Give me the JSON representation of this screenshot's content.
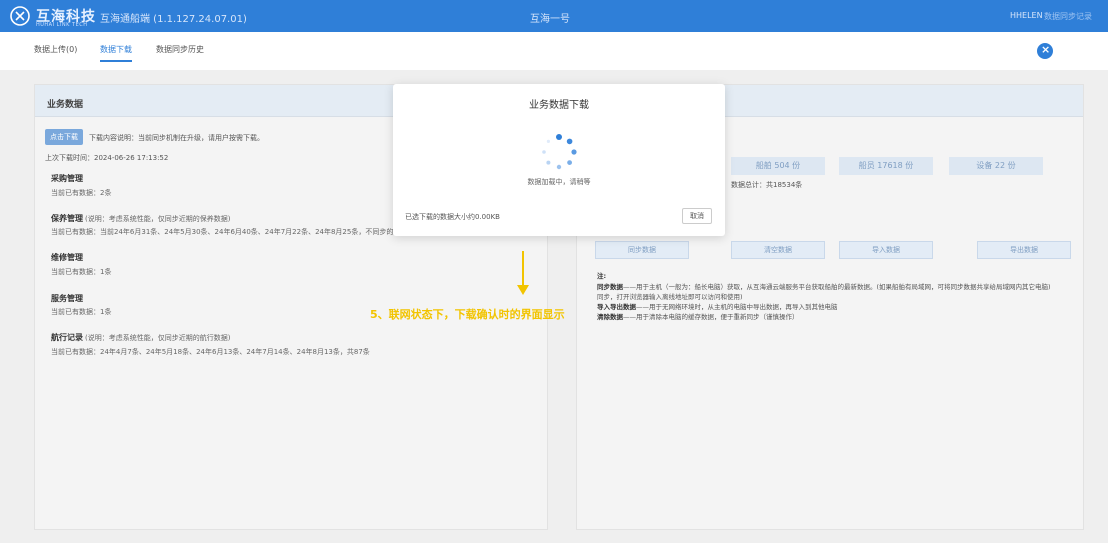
{
  "header": {
    "brand": "互海科技",
    "brand_sub": "HUHAI LINK TECH",
    "app_name": "互海通船端 (1.1.127.24.07.01)",
    "center_title": "互海一号",
    "user": "HHELEN",
    "user_menu": "数据同步记录"
  },
  "tabs": [
    {
      "label": "数据上传(0)"
    },
    {
      "label": "数据下载"
    },
    {
      "label": "数据同步历史"
    }
  ],
  "left_panel": {
    "title": "业务数据",
    "download_button": "点击下载",
    "hint": "下载内容说明：当前同步机制在升级，请用户按需下载。",
    "last_download": "上次下载时间：2024-06-26 17:13:52",
    "sections": [
      {
        "title": "采购管理",
        "note": "",
        "count": "当前已有数据：2条"
      },
      {
        "title": "保养管理",
        "note": "(说明：考虑系统性能，仅同步近期的保养数据)",
        "count": "当前已有数据：当前24年6月31条、24年5月30条、24年6月40条、24年7月22条、24年8月25条，不同步的数据"
      },
      {
        "title": "维修管理",
        "note": "",
        "count": "当前已有数据：1条"
      },
      {
        "title": "服务管理",
        "note": "",
        "count": "当前已有数据：1条"
      },
      {
        "title": "航行记录",
        "note": "(说明：考虑系统性能，仅同步近期的航行数据)",
        "count": "当前已有数据：24年4月7条、24年5月18条、24年6月13条、24年7月14条、24年8月13条，共87条"
      }
    ]
  },
  "right_panel": {
    "stats": [
      "船舶 504 份",
      "船员 17618 份",
      "设备 22 份"
    ],
    "count": "数据总计：共18534条",
    "actions": [
      "同步数据",
      "清空数据",
      "导入数据",
      "导出数据"
    ],
    "notes": [
      {
        "bold": "注:",
        "text": ""
      },
      {
        "bold": "同步数据",
        "text": "——用于主机（一般为：船长电脑）获取，从互海通云端服务平台获取船舶的最新数据。(如果船舶有局域网，可将同步数据共享给局域网内其它电脑)"
      },
      {
        "bold": "",
        "text": "同步，打开浏览器输入离线地址即可以访问和使用)"
      },
      {
        "bold": "导入导出数据",
        "text": "——用于无网络环境时，从主机的电脑中导出数据，再导入到其他电脑"
      },
      {
        "bold": "清除数据",
        "text": "——用于清除本电脑的缓存数据，便于重新同步（谨慎操作）"
      }
    ]
  },
  "modal": {
    "title": "业务数据下载",
    "loading": "数据加载中，请稍等",
    "info": "已选下载的数据大小约0.00KB",
    "cancel": "取消"
  },
  "annotation": "5、联网状态下，下载确认时的界面显示",
  "colors": {
    "primary": "#2f7fd8",
    "annotation": "#f2c400"
  }
}
